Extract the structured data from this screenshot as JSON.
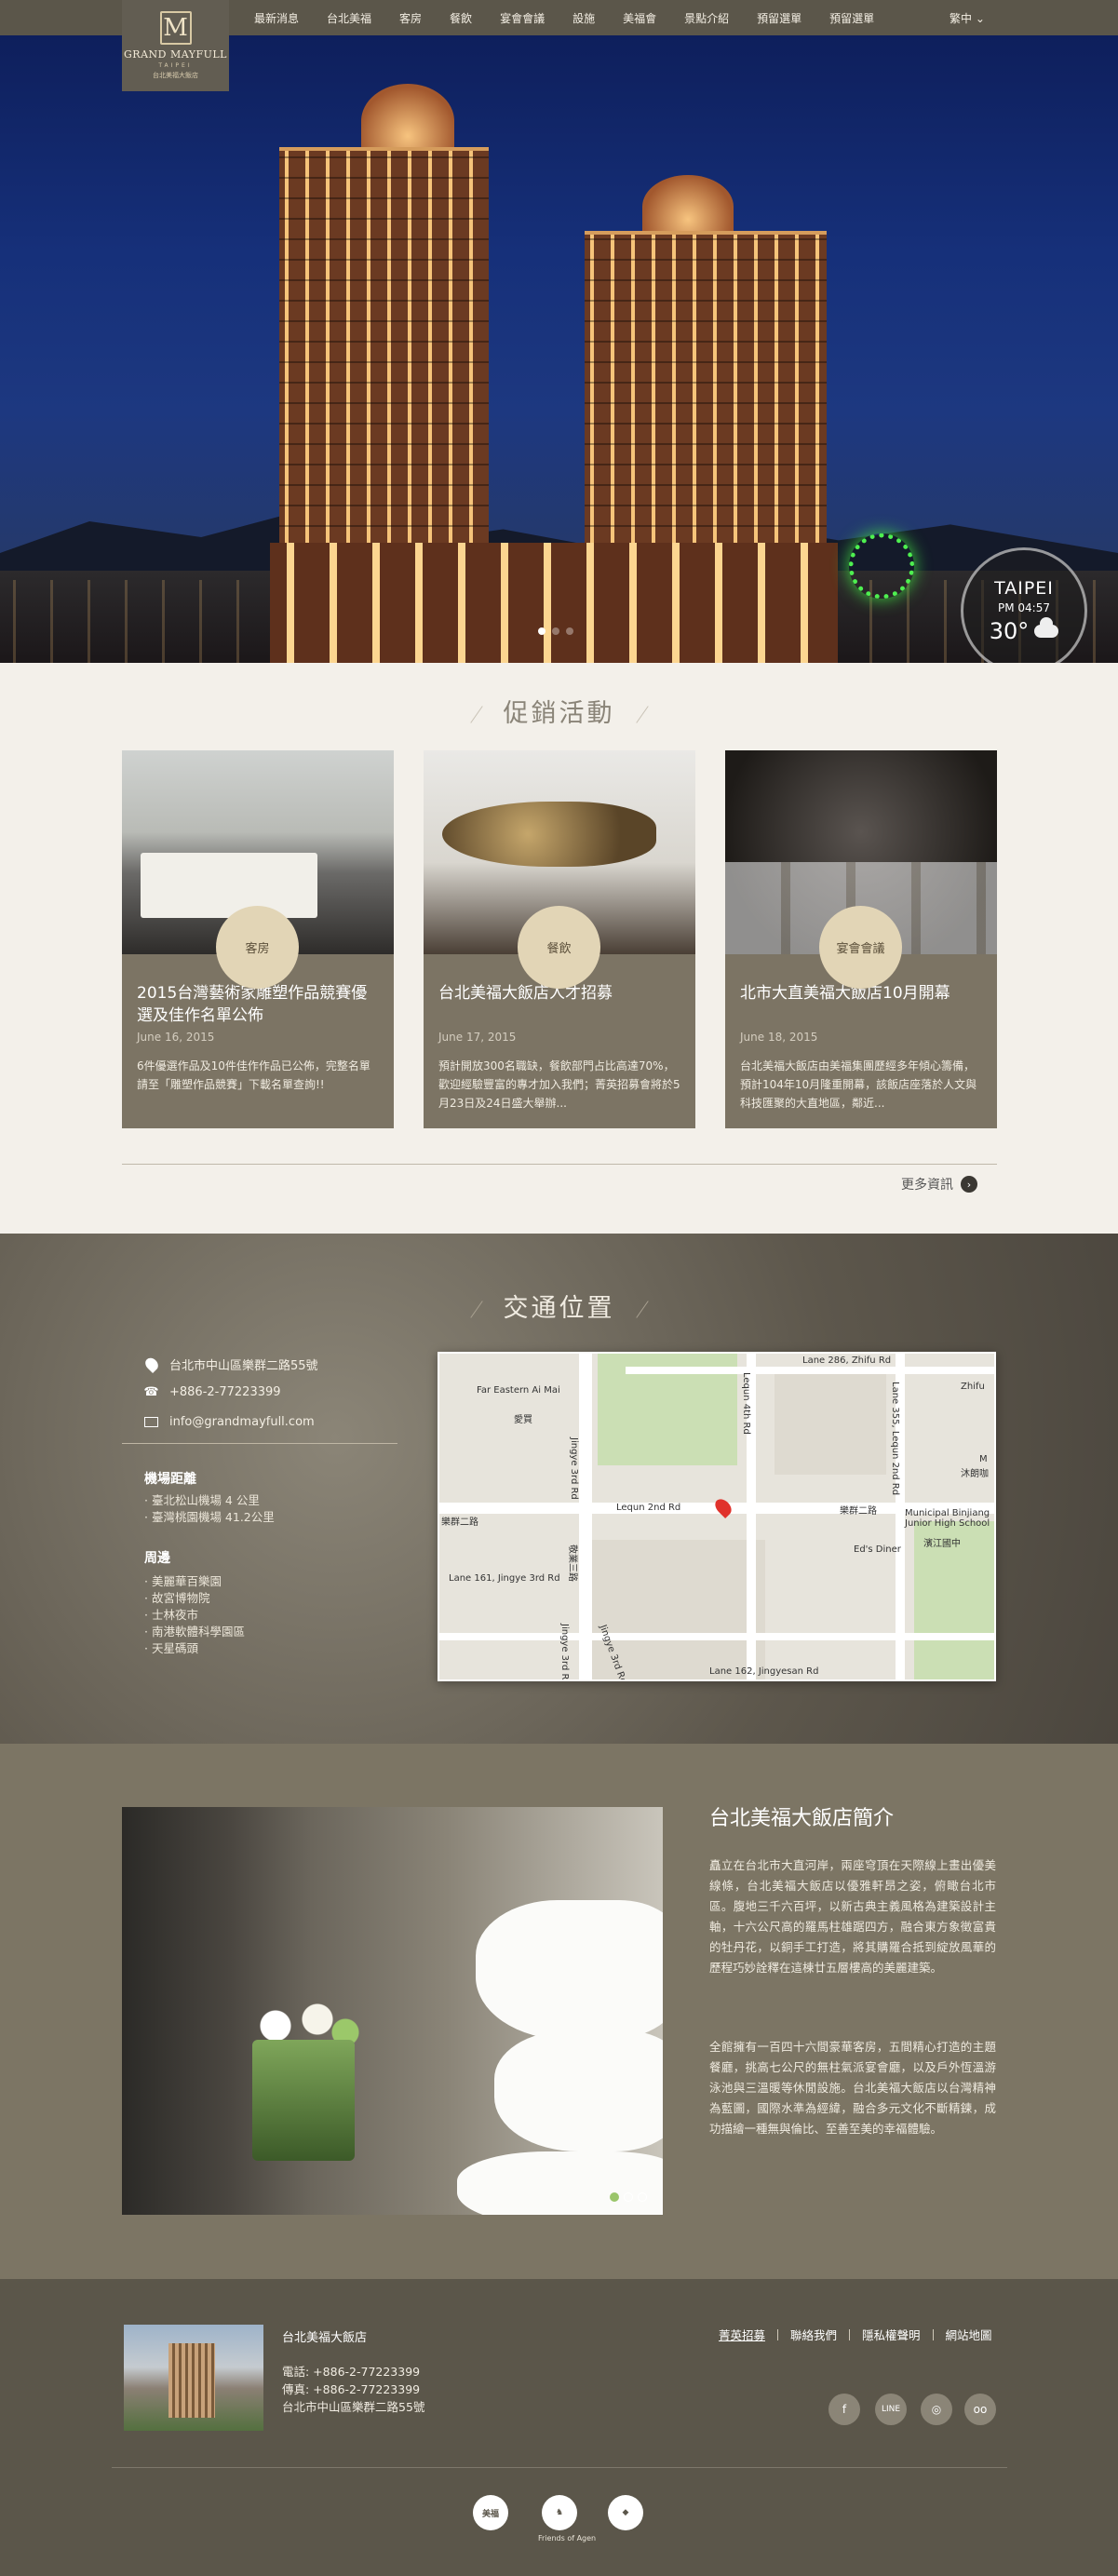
{
  "logo": {
    "name": "GRAND MAYFULL",
    "city": "TAIPEI",
    "cn": "台北美福大飯店",
    "mark": "M"
  },
  "nav": {
    "items": [
      "最新消息",
      "台北美福",
      "客房",
      "餐飲",
      "宴會會議",
      "設施",
      "美福會",
      "景點介紹",
      "預留選單",
      "預留選單"
    ],
    "lang": "繁中 ⌄"
  },
  "hero": {
    "weather": {
      "city": "TAIPEI",
      "time": "PM 04:57",
      "temp": "30°"
    }
  },
  "promo": {
    "title": "促銷活動",
    "cards": [
      {
        "badge": "客房",
        "title": "2015台灣藝術家雕塑作品競賽優選及佳作名單公佈",
        "date": "June 16, 2015",
        "desc": "6件優選作品及10件佳作作品已公佈，完整名單請至「雕塑作品競賽」下載名單查詢!!"
      },
      {
        "badge": "餐飲",
        "title": "台北美福大飯店人才招募",
        "date": "June 17, 2015",
        "desc": "預計開放300名職缺，餐飲部門占比高達70%，歡迎經驗豐富的專才加入我們；菁英招募會將於5月23日及24日盛大舉辦..."
      },
      {
        "badge": "宴會會議",
        "title": "北市大直美福大飯店10月開幕",
        "date": "June 18, 2015",
        "desc": "台北美福大飯店由美福集團歷經多年傾心籌備，預計104年10月隆重開幕，該飯店座落於人文與科技匯聚的大直地區，鄰近..."
      }
    ],
    "more": "更多資訊",
    "more_icon": "›"
  },
  "location": {
    "title": "交通位置",
    "address": "台北市中山區樂群二路55號",
    "phone": "+886-2-77223399",
    "email": "info@grandmayfull.com",
    "airport_title": "機場距離",
    "airports": [
      "· 臺北松山機場 4 公里",
      "· 臺灣桃園機場 41.2公里"
    ],
    "nearby_title": "周邊",
    "nearby": [
      "· 美麗華百樂園",
      "· 故宮博物院",
      "· 士林夜市",
      "· 南港軟體科學園區",
      "· 天星碼頭"
    ],
    "map_labels": {
      "far_eastern": "Far Eastern Ai Mai",
      "far_eastern_cn": "愛買",
      "lane286": "Lane 286, Zhifu Rd",
      "jingye3": "Jingye 3rd Rd",
      "lequn4": "Lequn 4th Rd",
      "lequn2": "Lequn 2nd Rd",
      "lequn2_cn": "樂群二路",
      "lequn2_cn2": "樂群二路",
      "lane355": "Lane 355, Lequn 2nd Rd",
      "lane161": "Lane 161, Jingye 3rd Rd",
      "jingye3_cn": "敬業三路",
      "jingye3b": "Jingye 3rd Rd",
      "jingye3c": "Jingye 3rd Rd",
      "lane162": "Lane 162, Jingyesan Rd",
      "ed_diner": "Ed's Diner",
      "school": "Municipal Binjiang Junior High School",
      "school_cn": "濱江國中",
      "zhifu": "Zhifu",
      "mei": "M",
      "mucha": "沐朗咖"
    }
  },
  "about": {
    "title": "台北美福大飯店簡介",
    "p1": "矗立在台北市大直河岸，兩座穹頂在天際線上畫出優美線條，台北美福大飯店以優雅軒昂之姿，俯瞰台北市區。腹地三千六百坪，以新古典主義風格為建築設計主軸，十六公尺高的羅馬柱雄踞四方，融合東方象徵富貴的牡丹花，以銅手工打造，將其購羅合抵到綻放風華的歷程巧妙詮釋在這棟廿五層樓高的美麗建築。",
    "p2": "全館擁有一百四十六間豪華客房，五間精心打造的主題餐廳，挑高七公尺的無柱氣派宴會廳，以及戶外恆溫游泳池與三溫暖等休閒設施。台北美福大飯店以台灣精神為藍圖，國際水準為經緯，融合多元文化不斷精鍊，成功描繪一種無與倫比、至善至美的幸福體驗。"
  },
  "footer": {
    "name": "台北美福大飯店",
    "phone": "電話: +886-2-77223399",
    "fax": "傳真: +886-2-77223399",
    "address": "台北市中山區樂群二路55號",
    "links": [
      "菁英招募",
      "聯絡我們",
      "隱私權聲明",
      "網站地圖"
    ],
    "social": [
      "f",
      "LINE",
      "◎",
      "oo"
    ],
    "partners": [
      {
        "mark": "美福",
        "label": "美福"
      },
      {
        "mark": "♞",
        "label": "Friends of Agen"
      },
      {
        "mark": "◆",
        "label": ""
      }
    ]
  }
}
